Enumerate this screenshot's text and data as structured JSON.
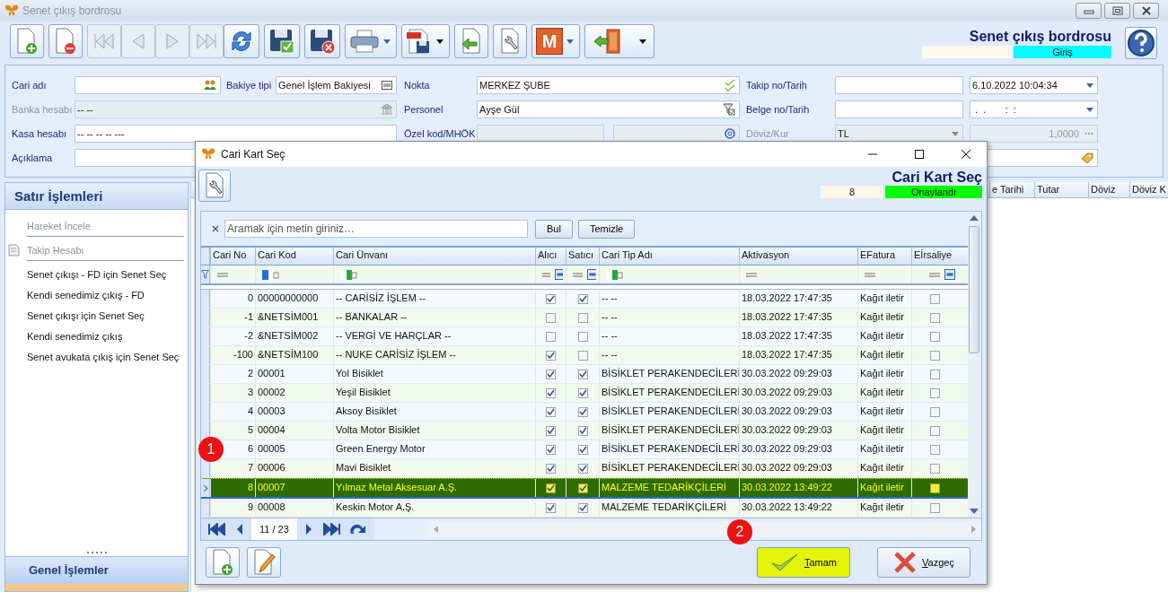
{
  "window": {
    "title": "Senet çıkış bordrosu"
  },
  "toolbar": [
    {
      "kind": "new",
      "disabled": false
    },
    {
      "kind": "delete",
      "disabled": false
    },
    {
      "kind": "first",
      "disabled": true
    },
    {
      "kind": "prev",
      "disabled": true
    },
    {
      "kind": "next",
      "disabled": true
    },
    {
      "kind": "last",
      "disabled": true
    },
    {
      "kind": "refresh",
      "disabled": false
    },
    {
      "kind": "save",
      "disabled": false
    },
    {
      "kind": "discard",
      "disabled": false
    },
    {
      "kind": "print",
      "disabled": false
    },
    {
      "kind": "pdf",
      "disabled": false
    },
    {
      "kind": "import",
      "disabled": false
    },
    {
      "kind": "tools",
      "disabled": false
    },
    {
      "kind": "m",
      "label": "M",
      "disabled": false
    },
    {
      "kind": "exit",
      "disabled": false
    }
  ],
  "header": {
    "title": "Senet çıkış bordrosu",
    "status": "Giriş"
  },
  "form": {
    "cari_adi": {
      "label": "Cari adı"
    },
    "bakiye_tipi": {
      "label": "Bakiye tipi",
      "value": "Genel İşlem Bakiyesi"
    },
    "nokta": {
      "label": "Nokta",
      "value": "MERKEZ ŞUBE"
    },
    "takip": {
      "label": "Takip no/Tarih",
      "date": "6.10.2022 10:04:34"
    },
    "banka": {
      "label": "Banka hesabı",
      "value": "-- --",
      "disabled": true
    },
    "personel": {
      "label": "Personel",
      "value": "Ayşe Gül"
    },
    "belge": {
      "label": "Belge no/Tarih",
      "date": " .  .       :  :"
    },
    "kasa": {
      "label": "Kasa hesabı",
      "value": "-- -- -- -- ---"
    },
    "ozel": {
      "label": "Özel kod/MHÖK"
    },
    "doviz": {
      "label": "Döviz/Kur",
      "value": "TL",
      "rate": "1,0000",
      "disabled": true
    },
    "aciklama": {
      "label": "Açıklama"
    }
  },
  "sidebar": {
    "title": "Satır İşlemleri",
    "items": [
      {
        "label": "Hareket İncele",
        "disabled": true,
        "kind": "plain"
      },
      {
        "label": "Takip Hesabı",
        "disabled": true,
        "kind": "report"
      },
      {
        "label": "Senet çıkışı - FD için Senet Seç",
        "disabled": false,
        "kind": "plain"
      },
      {
        "label": "Kendi senedimiz çıkış - FD",
        "disabled": false,
        "kind": "plain"
      },
      {
        "label": "Senet çıkışı için Senet Seç",
        "disabled": false,
        "kind": "plain"
      },
      {
        "label": "Kendi senedimiz çıkış",
        "disabled": false,
        "kind": "plain"
      },
      {
        "label": "Senet avukata çıkış için Senet Seç",
        "disabled": false,
        "kind": "plain"
      }
    ],
    "footer": "Genel İşlemler"
  },
  "background_table": {
    "columns": [
      "e Tarihi",
      "Tutar",
      "Döviz",
      "Döviz K"
    ]
  },
  "dialog": {
    "title": "Cari Kart Seç",
    "heading": "Cari Kart Seç",
    "count": "8",
    "status": "Onaylandı",
    "search": {
      "placeholder": "Aramak için metin giriniz…",
      "find": "Bul",
      "clear": "Temizle"
    },
    "columns": [
      "Cari No",
      "Cari Kod",
      "Cari Ünvanı",
      "Alıcı",
      "Satıcı",
      "Cari Tip Adı",
      "Aktivasyon",
      "EFatura",
      "Eİrsaliye"
    ],
    "rows": [
      {
        "no": "0",
        "code": "00000000000",
        "name": "-- CARİSİZ İŞLEM --",
        "alici": true,
        "satici": true,
        "type": "-- --",
        "activation": "18.03.2022 17:47:35",
        "efatura": "Kağıt iletir",
        "eirsaliye": false,
        "selected": false
      },
      {
        "no": "-1",
        "code": "&NETSİM001",
        "name": "-- BANKALAR --",
        "alici": false,
        "satici": false,
        "type": "-- --",
        "activation": "18.03.2022 17:47:35",
        "efatura": "Kağıt iletir",
        "eirsaliye": false,
        "selected": false
      },
      {
        "no": "-2",
        "code": "&NETSİM002",
        "name": "-- VERGİ VE HARÇLAR --",
        "alici": false,
        "satici": false,
        "type": "-- --",
        "activation": "18.03.2022 17:47:35",
        "efatura": "Kağıt iletir",
        "eirsaliye": false,
        "selected": false
      },
      {
        "no": "-100",
        "code": "&NETSİM100",
        "name": "-- NUKE CARİSİZ İŞLEM --",
        "alici": true,
        "satici": false,
        "type": "-- --",
        "activation": "18.03.2022 17:47:35",
        "efatura": "Kağıt iletir",
        "eirsaliye": false,
        "selected": false
      },
      {
        "no": "2",
        "code": "00001",
        "name": "Yol Bisiklet",
        "alici": true,
        "satici": true,
        "type": "BİSİKLET PERAKENDECİLERİ",
        "activation": "30.03.2022 09:29:03",
        "efatura": "Kağıt iletir",
        "eirsaliye": false,
        "selected": false
      },
      {
        "no": "3",
        "code": "00002",
        "name": "Yeşil Bisiklet",
        "alici": true,
        "satici": true,
        "type": "BİSİKLET PERAKENDECİLERİ",
        "activation": "30.03.2022 09:29:03",
        "efatura": "Kağıt iletir",
        "eirsaliye": false,
        "selected": false
      },
      {
        "no": "4",
        "code": "00003",
        "name": "Aksoy Bisiklet",
        "alici": true,
        "satici": true,
        "type": "BİSİKLET PERAKENDECİLERİ",
        "activation": "30.03.2022 09:29:03",
        "efatura": "Kağıt iletir",
        "eirsaliye": false,
        "selected": false
      },
      {
        "no": "5",
        "code": "00004",
        "name": "Volta Motor Bisiklet",
        "alici": true,
        "satici": true,
        "type": "BİSİKLET PERAKENDECİLERİ",
        "activation": "30.03.2022 09:29:03",
        "efatura": "Kağıt iletir",
        "eirsaliye": false,
        "selected": false
      },
      {
        "no": "6",
        "code": "00005",
        "name": "Green Energy Motor",
        "alici": true,
        "satici": true,
        "type": "BİSİKLET PERAKENDECİLERİ",
        "activation": "30.03.2022 09:29:03",
        "efatura": "Kağıt iletir",
        "eirsaliye": false,
        "selected": false
      },
      {
        "no": "7",
        "code": "00006",
        "name": "Mavi Bisiklet",
        "alici": true,
        "satici": true,
        "type": "BİSİKLET PERAKENDECİLERİ",
        "activation": "30.03.2022 09:29:03",
        "efatura": "Kağıt iletir",
        "eirsaliye": false,
        "selected": false
      },
      {
        "no": "8",
        "code": "00007",
        "name": "Yılmaz Metal Aksesuar A.Ş.",
        "alici": true,
        "satici": true,
        "type": "MALZEME TEDARİKÇİLERİ",
        "activation": "30.03.2022 13:49:22",
        "efatura": "Kağıt iletir",
        "eirsaliye": false,
        "selected": true
      },
      {
        "no": "9",
        "code": "00008",
        "name": "Keskin Motor A.Ş.",
        "alici": true,
        "satici": true,
        "type": "MALZEME TEDARİKÇİLERİ",
        "activation": "30.03.2022 13:49:22",
        "efatura": "Kağıt iletir",
        "eirsaliye": false,
        "selected": false
      }
    ],
    "pager": "11 / 23",
    "buttons": [
      {
        "kind": "ok",
        "label": "Tamam",
        "highlighted": true
      },
      {
        "kind": "cancel",
        "label": "Vazgeç",
        "highlighted": false
      }
    ]
  },
  "callouts": [
    {
      "label": "1"
    },
    {
      "label": "2"
    }
  ]
}
